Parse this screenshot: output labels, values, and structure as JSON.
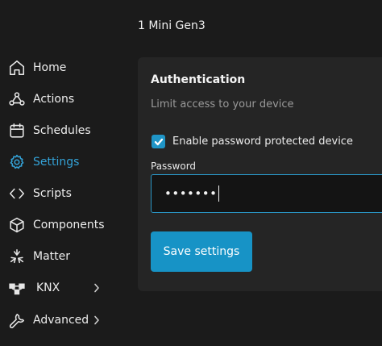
{
  "header": {
    "device_title": "1 Mini Gen3"
  },
  "sidebar": {
    "items": [
      {
        "label": "Home",
        "icon": "home-icon",
        "active": false
      },
      {
        "label": "Actions",
        "icon": "actions-icon",
        "active": false
      },
      {
        "label": "Schedules",
        "icon": "calendar-icon",
        "active": false
      },
      {
        "label": "Settings",
        "icon": "gear-icon",
        "active": true
      },
      {
        "label": "Scripts",
        "icon": "code-icon",
        "active": false
      },
      {
        "label": "Components",
        "icon": "cube-icon",
        "active": false
      },
      {
        "label": "Matter",
        "icon": "matter-icon",
        "active": false
      },
      {
        "label": "KNX",
        "icon": "knx-icon",
        "active": false,
        "has_submenu": true
      },
      {
        "label": "Advanced",
        "icon": "wrench-icon",
        "active": false,
        "has_submenu": true
      }
    ],
    "active_color": "#34a3d8"
  },
  "auth": {
    "title": "Authentication",
    "subtitle": "Limit access to your device",
    "checkbox_label": "Enable password protected device",
    "checkbox_checked": true,
    "password_label": "Password",
    "password_value": "•••••••",
    "save_label": "Save settings"
  },
  "colors": {
    "background": "#1b1b1b",
    "card": "#252525",
    "accent": "#1793c6"
  }
}
